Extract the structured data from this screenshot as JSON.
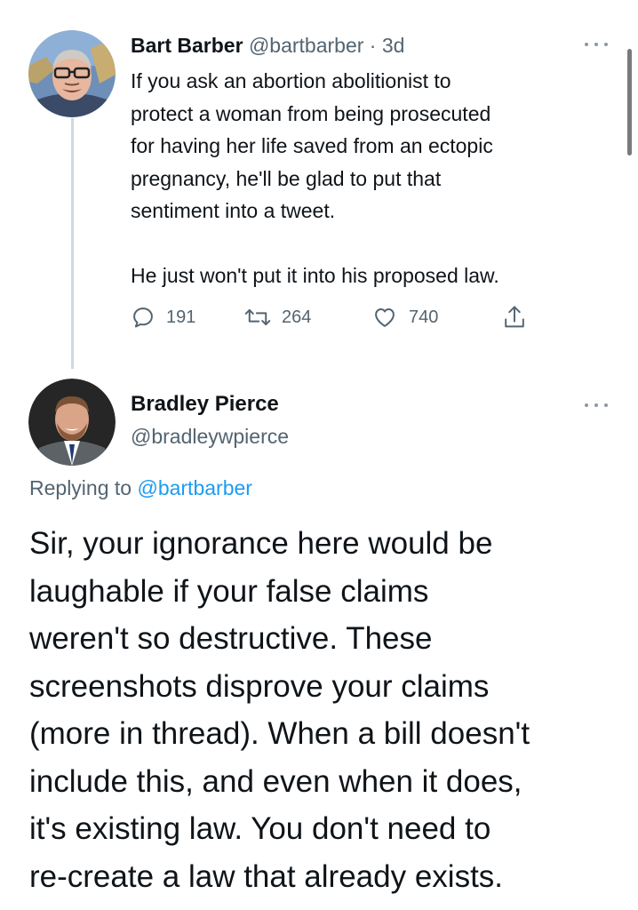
{
  "tweet1": {
    "author_name": "Bart Barber",
    "author_handle": "@bartbarber",
    "separator": "·",
    "timestamp": "3d",
    "text_lines": [
      "If you ask an abortion abolitionist to",
      "protect a woman from being prosecuted",
      "for having her life saved from an ectopic",
      "pregnancy, he'll be glad to put that",
      "sentiment into a tweet."
    ],
    "text_line_2": "He just won't put it into his proposed law.",
    "actions": {
      "reply_count": "191",
      "retweet_count": "264",
      "like_count": "740"
    }
  },
  "tweet2": {
    "author_name": "Bradley Pierce",
    "author_handle": "@bradleywpierce",
    "replying_prefix": "Replying to",
    "replying_mention": "@bartbarber",
    "text_lines": [
      "Sir, your ignorance here would be",
      "laughable if your false claims",
      "weren't so destructive. These",
      "screenshots disprove your claims",
      "(more in thread). When a bill doesn't",
      "include this, and even when it does,",
      "it's  existing law. You don't need to",
      "re-create a law that already exists."
    ]
  },
  "icons": {
    "more": "more-horizontal-icon",
    "reply": "reply-icon",
    "retweet": "retweet-icon",
    "like": "heart-icon",
    "share": "share-icon"
  },
  "colors": {
    "text_primary": "#0f1419",
    "text_secondary": "#536471",
    "link": "#1d9bf0",
    "thread_line": "#cfd9de"
  }
}
